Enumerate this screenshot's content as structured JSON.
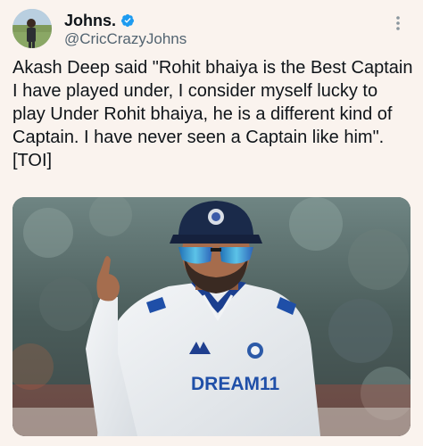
{
  "post": {
    "display_name": "Johns.",
    "handle": "@CricCrazyJohns",
    "text": "Akash Deep said \"Rohit bhaiya is the Best Captain I have played under, I consider myself lucky to play Under Rohit bhaiya, he is a different kind of Captain. I have never seen a Captain like him\". [TOI]",
    "verified": true
  },
  "media": {
    "jersey_text": "DREAM11"
  },
  "colors": {
    "background": "#faf3ee",
    "verified_blue": "#1d9bf0",
    "text_primary": "#0f1419",
    "text_secondary": "#536471"
  },
  "icons": {
    "verified": "verified-badge-icon",
    "more": "more-options-icon"
  }
}
